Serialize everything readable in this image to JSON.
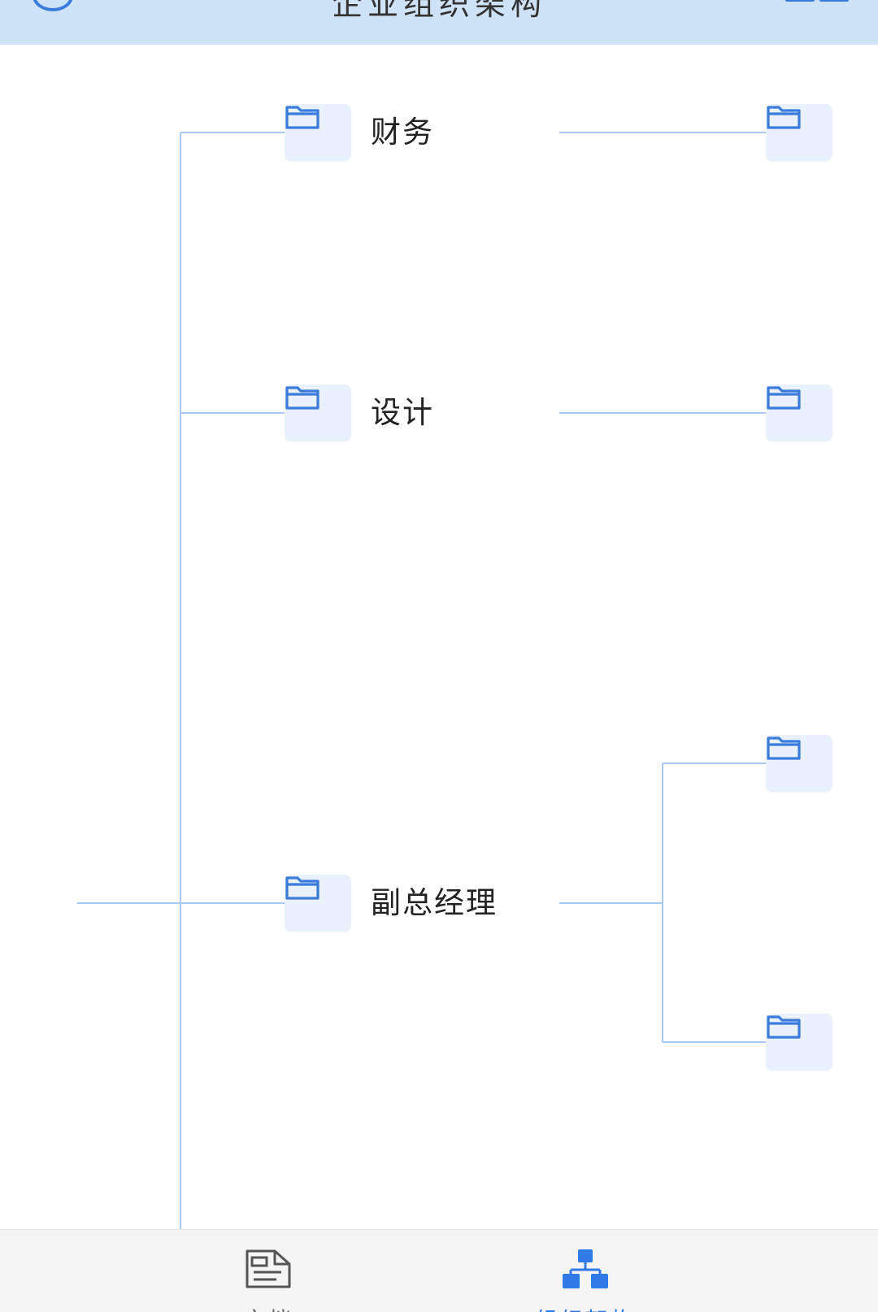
{
  "header": {
    "title": "企业组织架构",
    "back_icon": "back-circle-icon",
    "menu_icon": "menu-icon"
  },
  "tree": {
    "nodes": [
      {
        "label": "财务"
      },
      {
        "label": "设计"
      },
      {
        "label": "副总经理"
      }
    ],
    "child_nodes": [
      {
        "parent": "财务"
      },
      {
        "parent": "设计"
      },
      {
        "parent": "副总经理"
      },
      {
        "parent": "副总经理"
      }
    ],
    "colors": {
      "line": "#a9c8ee",
      "folder": "#3b7bdc",
      "node_bg": "#e8f1fc"
    }
  },
  "tabbar": {
    "tabs": [
      {
        "label": "文档",
        "icon": "document-icon",
        "active": false
      },
      {
        "label": "组织架构",
        "icon": "org-chart-icon",
        "active": true
      }
    ],
    "colors": {
      "active": "#2f7ae5",
      "inactive": "#666666"
    }
  }
}
